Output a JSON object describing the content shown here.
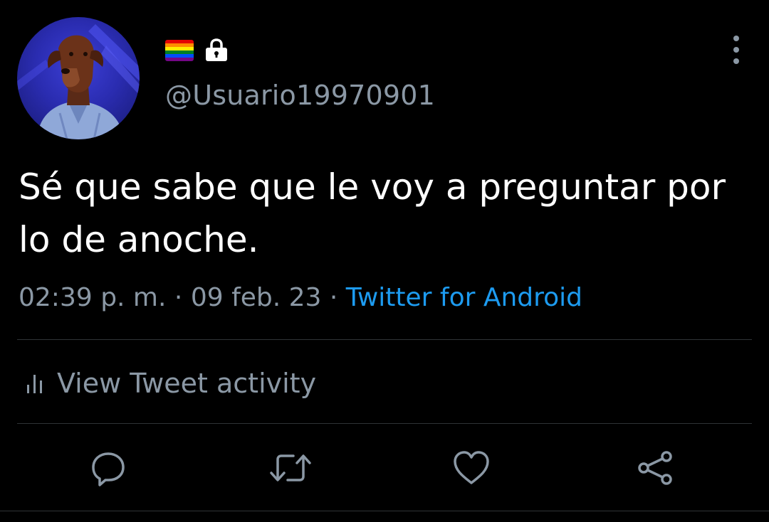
{
  "user": {
    "handle": "@Usuario19970901",
    "avatar_icon": "dog-in-shirt-avatar",
    "badges": [
      "rainbow-flag-icon",
      "lock-icon"
    ]
  },
  "tweet": {
    "text": "Sé que sabe que le voy a preguntar por lo de anoche.",
    "time": "02:39 p. m.",
    "separator": "·",
    "date": "09 feb. 23",
    "source": "Twitter for Android"
  },
  "activity": {
    "label": "View Tweet activity"
  },
  "actions": [
    "reply-icon",
    "retweet-icon",
    "like-icon",
    "share-icon"
  ],
  "colors": {
    "background": "#000000",
    "text": "#ffffff",
    "muted": "#8b98a5",
    "accent": "#1d9bf0",
    "divider": "#2f3336"
  }
}
